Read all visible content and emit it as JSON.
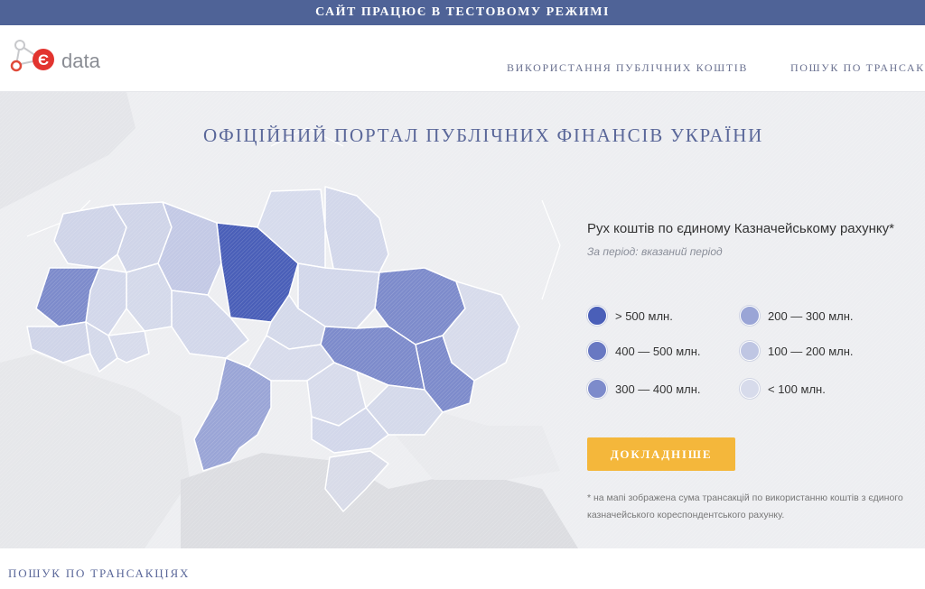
{
  "banner": {
    "text": "САЙТ ПРАЦЮЄ В ТЕСТОВОМУ РЕЖИМІ"
  },
  "header": {
    "logo_text": "data",
    "logo_letter": "Є",
    "nav": [
      {
        "label": "ВИКОРИСТАННЯ ПУБЛІЧНИХ КОШТІВ"
      },
      {
        "label": "ПОШУК ПО ТРАНСАКЦІЯХ"
      }
    ]
  },
  "hero": {
    "title": "ОФІЦІЙНИЙ ПОРТАЛ ПУБЛІЧНИХ ФІНАНСІВ УКРАЇНИ",
    "info": {
      "title": "Рух коштів по єдиному Казначейському рахунку*",
      "period": "За період: вказаний період"
    },
    "legend": [
      {
        "label": "> 500 млн.",
        "color": "#4a5fb8"
      },
      {
        "label": "400 — 500 млн.",
        "color": "#6878c2"
      },
      {
        "label": "300 — 400 млн.",
        "color": "#7d8bcb"
      },
      {
        "label": "200 — 300 млн.",
        "color": "#9aa5d6"
      },
      {
        "label": "100 — 200 млн.",
        "color": "#bfc6e3"
      },
      {
        "label": "< 100 млн.",
        "color": "#d7dbeb"
      }
    ],
    "button_label": "ДОКЛАДНІШЕ",
    "footnote": "* на мапі зображена сума трансакцій по використанню коштів з єдиного казначейського кореспондентського рахунку."
  },
  "section": {
    "title": "ПОШУК ПО ТРАНСАКЦІЯХ"
  },
  "colors": {
    "banner": "#4f6397",
    "accent_button": "#f4b73b",
    "hero_bg": "#edeef1",
    "title_blue": "#5a6799"
  },
  "icons": [
    "molecule-logo-icon"
  ]
}
